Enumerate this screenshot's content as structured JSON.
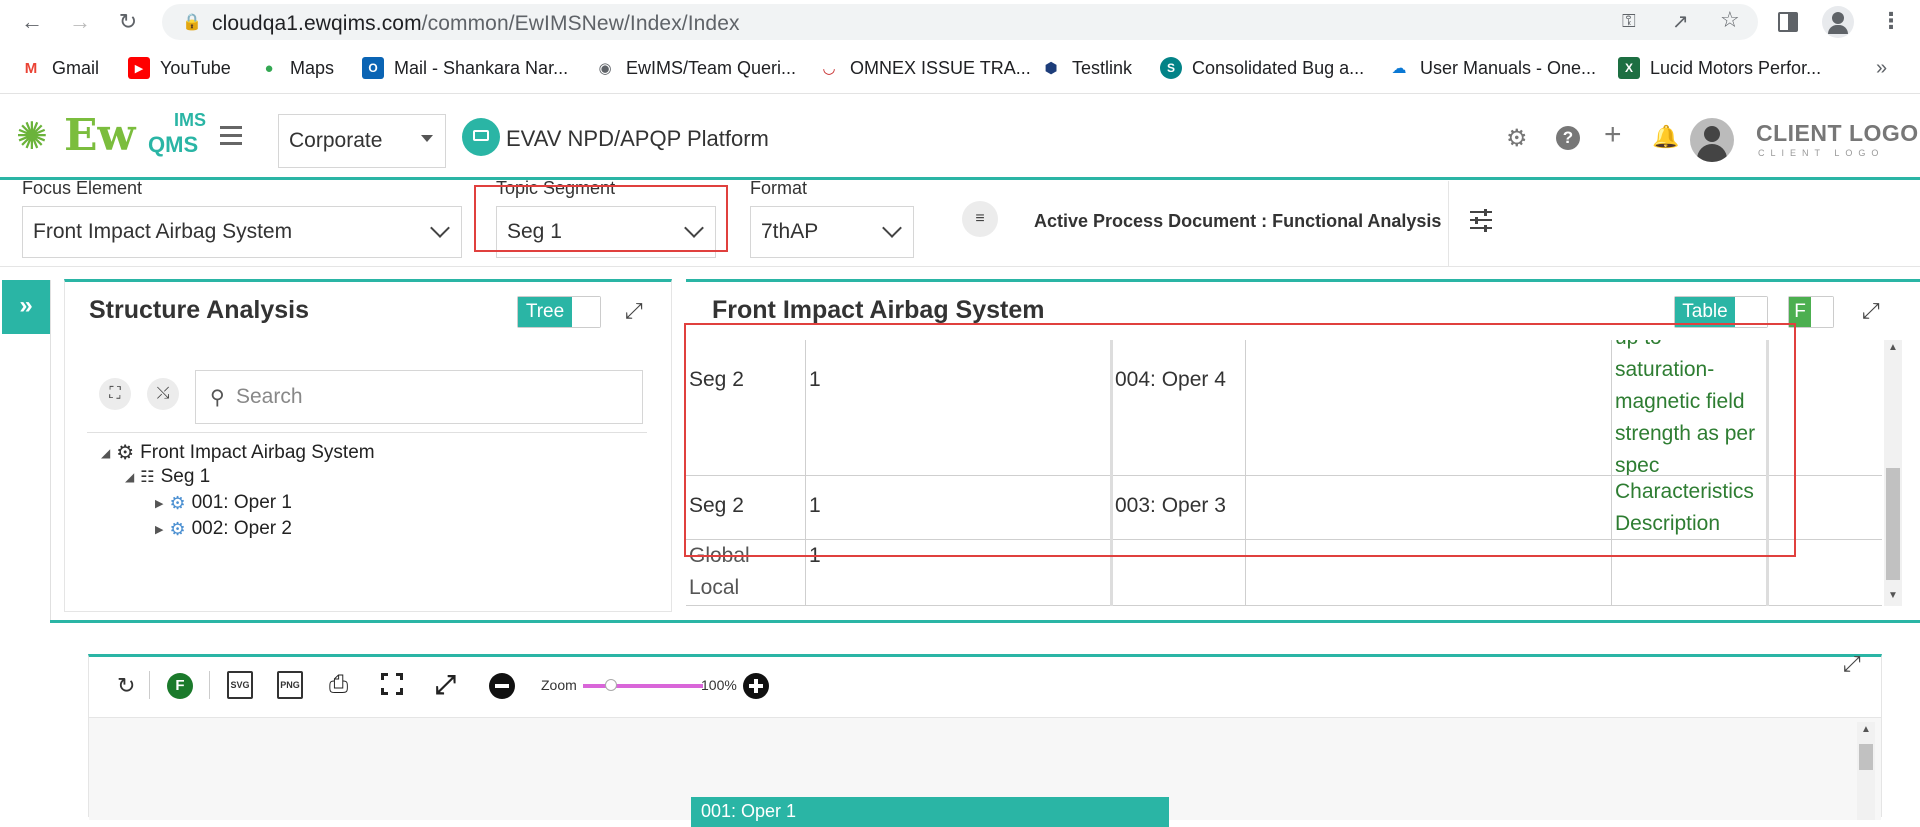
{
  "browser": {
    "url_domain": "cloudqa1.ewqims.com",
    "url_path": "/common/EwIMSNew/Index/Index",
    "bookmarks": [
      {
        "label": "Gmail"
      },
      {
        "label": "YouTube"
      },
      {
        "label": "Maps"
      },
      {
        "label": "Mail - Shankara Nar..."
      },
      {
        "label": "EwIMS/Team Queri..."
      },
      {
        "label": "OMNEX ISSUE TRA..."
      },
      {
        "label": "Testlink"
      },
      {
        "label": "Consolidated Bug a..."
      },
      {
        "label": "User Manuals - One..."
      },
      {
        "label": "Lucid Motors Perfor..."
      }
    ],
    "more": "»"
  },
  "header": {
    "logo_main": "Ew",
    "logo_ims": "IMS",
    "logo_qms": "QMS",
    "menu_icon": "hamburger-icon",
    "org_select": "Corporate",
    "platform_title": "EVAV NPD/APQP Platform",
    "client_logo": "CLIENT LOGO",
    "client_logo_sub": "CLIENT LOGO"
  },
  "filters": {
    "focus_label": "Focus Element",
    "focus_value": "Front Impact Airbag System",
    "topic_label": "Topic Segment",
    "topic_value": "Seg 1",
    "format_label": "Format",
    "format_value": "7thAP",
    "active_doc": "Active Process Document : Functional Analysis"
  },
  "structure": {
    "title": "Structure Analysis",
    "toggle_label": "Tree",
    "search_placeholder": "Search",
    "tree": [
      {
        "label": "Front Impact Airbag System"
      },
      {
        "label": "Seg 1"
      },
      {
        "label": "001: Oper 1"
      },
      {
        "label": "002: Oper 2"
      }
    ]
  },
  "detail": {
    "title": "Front Impact Airbag System",
    "toggle_label": "Table",
    "f_label": "F",
    "rows": [
      {
        "c1": "Seg 2",
        "c2": "1",
        "c3": "004: Oper 4",
        "c4": "",
        "c5_lines": [
          "up to",
          "saturation-",
          "magnetic field",
          "strength as per",
          "spec"
        ]
      },
      {
        "c1": "Seg 2",
        "c2": "1",
        "c3": "003: Oper 3",
        "c4": "",
        "c5_lines": [
          "Characteristics",
          "Description"
        ]
      },
      {
        "c1_lines": [
          "Global-",
          "Local"
        ],
        "c2": "1",
        "c3": "",
        "c4": "",
        "c5_lines": []
      }
    ]
  },
  "diagram": {
    "zoom_label": "Zoom",
    "zoom_value": "100%",
    "zoom_level": 0.2,
    "node_label": "001: Oper 1",
    "svg_label": "SVG",
    "png_label": "PNG",
    "f_badge": "F"
  },
  "colors": {
    "teal": "#2ab5a5",
    "red_highlight": "#e0403e",
    "green_text": "#2e7d32"
  }
}
